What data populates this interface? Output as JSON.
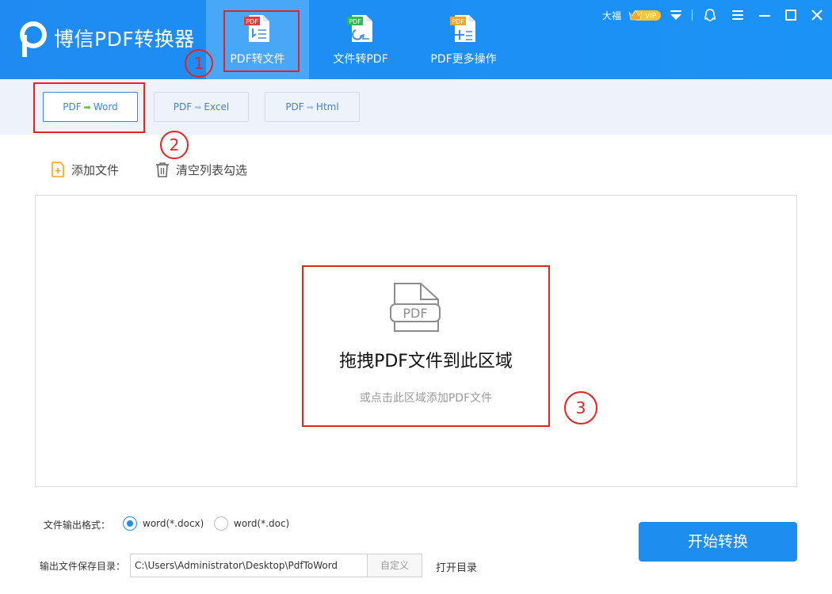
{
  "app": {
    "title": "博信PDF转换器"
  },
  "main_tabs": [
    {
      "label": "PDF转文件",
      "icon_badge": "PDF",
      "icon": "pdf-to-file-icon",
      "active": true
    },
    {
      "label": "文件转PDF",
      "icon_badge": "PDF",
      "icon": "file-to-pdf-icon",
      "active": false
    },
    {
      "label": "PDF更多操作",
      "icon_badge": "PDF",
      "icon": "pdf-more-icon",
      "active": false
    }
  ],
  "user": {
    "name": "大福",
    "vip_label": "VIP"
  },
  "sub_tabs": [
    {
      "from": "PDF",
      "arrow": "➡",
      "to": "Word",
      "active": true
    },
    {
      "from": "PDF",
      "arrow": "➡",
      "to": "Excel",
      "active": false
    },
    {
      "from": "PDF",
      "arrow": "➡",
      "to": "Html",
      "active": false
    }
  ],
  "actions": {
    "add_file": "添加文件",
    "clear_list": "清空列表勾选"
  },
  "drop_zone": {
    "file_icon_text": "PDF",
    "title": "拖拽PDF文件到此区域",
    "hint": "或点击此区域添加PDF文件"
  },
  "annotations": [
    "1",
    "2",
    "3"
  ],
  "output_format": {
    "label": "文件输出格式：",
    "options": [
      {
        "label": "word(*.docx)",
        "checked": true
      },
      {
        "label": "word(*.doc)",
        "checked": false
      }
    ]
  },
  "output_dir": {
    "label": "输出文件保存目录：",
    "path": "C:\\Users\\Administrator\\Desktop\\PdfToWord",
    "custom_label": "自定义",
    "open_label": "打开目录"
  },
  "start_button": "开始转换",
  "colors": {
    "header_blue": "#1f8bf2",
    "active_tab": "#49a7f8",
    "annotation_red": "#e8231f",
    "primary": "#1d8ef0"
  }
}
